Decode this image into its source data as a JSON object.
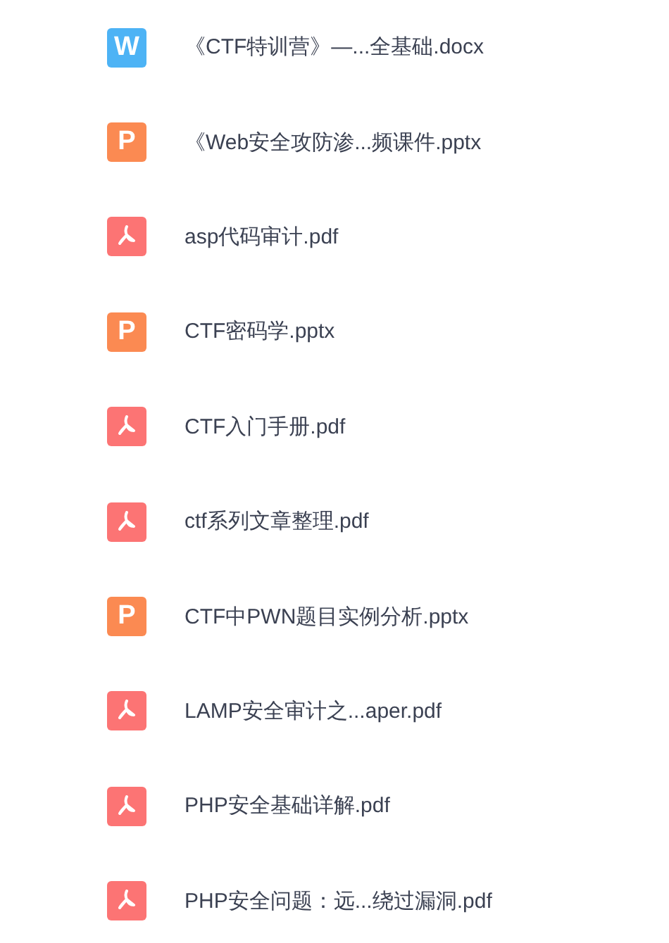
{
  "files": [
    {
      "kind": "word",
      "letter": "W",
      "name": "《CTF特训营》—...全基础.docx"
    },
    {
      "kind": "ppt",
      "letter": "P",
      "name": "《Web安全攻防渗...频课件.pptx"
    },
    {
      "kind": "pdf",
      "name": "asp代码审计.pdf"
    },
    {
      "kind": "ppt",
      "letter": "P",
      "name": "CTF密码学.pptx"
    },
    {
      "kind": "pdf",
      "name": "CTF入门手册.pdf"
    },
    {
      "kind": "pdf",
      "name": "ctf系列文章整理.pdf"
    },
    {
      "kind": "ppt",
      "letter": "P",
      "name": "CTF中PWN题目实例分析.pptx"
    },
    {
      "kind": "pdf",
      "name": "LAMP安全审计之...aper.pdf"
    },
    {
      "kind": "pdf",
      "name": "PHP安全基础详解.pdf"
    },
    {
      "kind": "pdf",
      "name": "PHP安全问题：远...绕过漏洞.pdf"
    }
  ]
}
